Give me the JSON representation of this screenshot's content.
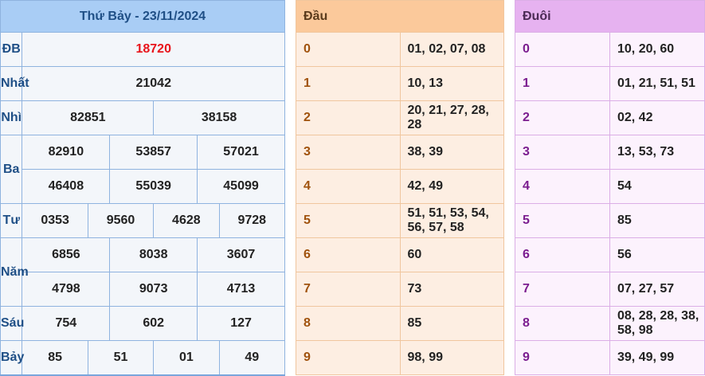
{
  "header": {
    "title": "Thứ Bảy - 23/11/2024"
  },
  "prizes": {
    "db": {
      "label": "ĐB",
      "numbers": [
        "18720"
      ]
    },
    "nhat": {
      "label": "Nhất",
      "numbers": [
        "21042"
      ]
    },
    "nhi": {
      "label": "Nhì",
      "numbers": [
        "82851",
        "38158"
      ]
    },
    "ba": {
      "label": "Ba",
      "numbers": [
        "82910",
        "53857",
        "57021",
        "46408",
        "55039",
        "45099"
      ]
    },
    "tu": {
      "label": "Tư",
      "numbers": [
        "0353",
        "9560",
        "4628",
        "9728"
      ]
    },
    "nam": {
      "label": "Năm",
      "numbers": [
        "6856",
        "8038",
        "3607",
        "4798",
        "9073",
        "4713"
      ]
    },
    "sau": {
      "label": "Sáu",
      "numbers": [
        "754",
        "602",
        "127"
      ]
    },
    "bay": {
      "label": "Bảy",
      "numbers": [
        "85",
        "51",
        "01",
        "49"
      ]
    }
  },
  "dau": {
    "header": "Đầu",
    "rows": [
      {
        "key": "0",
        "value": "01, 02, 07, 08"
      },
      {
        "key": "1",
        "value": "10, 13"
      },
      {
        "key": "2",
        "value": "20, 21, 27, 28, 28"
      },
      {
        "key": "3",
        "value": "38, 39"
      },
      {
        "key": "4",
        "value": "42, 49"
      },
      {
        "key": "5",
        "value": "51, 51, 53, 54, 56, 57, 58"
      },
      {
        "key": "6",
        "value": "60"
      },
      {
        "key": "7",
        "value": "73"
      },
      {
        "key": "8",
        "value": "85"
      },
      {
        "key": "9",
        "value": "98, 99"
      }
    ]
  },
  "duoi": {
    "header": "Đuôi",
    "rows": [
      {
        "key": "0",
        "value": "10, 20, 60"
      },
      {
        "key": "1",
        "value": "01, 21, 51, 51"
      },
      {
        "key": "2",
        "value": "02, 42"
      },
      {
        "key": "3",
        "value": "13, 53, 73"
      },
      {
        "key": "4",
        "value": "54"
      },
      {
        "key": "5",
        "value": "85"
      },
      {
        "key": "6",
        "value": "56"
      },
      {
        "key": "7",
        "value": "07, 27, 57"
      },
      {
        "key": "8",
        "value": "08, 28, 28, 38, 58, 98"
      },
      {
        "key": "9",
        "value": "39, 49, 99"
      }
    ]
  },
  "colors": {
    "results_header_bg": "#a9cdf5",
    "results_header_text": "#1f4f86",
    "special_prize": "#e8141b",
    "dau_header_bg": "#fbc99b",
    "dau_key": "#a0520d",
    "duoi_header_bg": "#e6b2f0",
    "duoi_key": "#7b1d8f"
  }
}
